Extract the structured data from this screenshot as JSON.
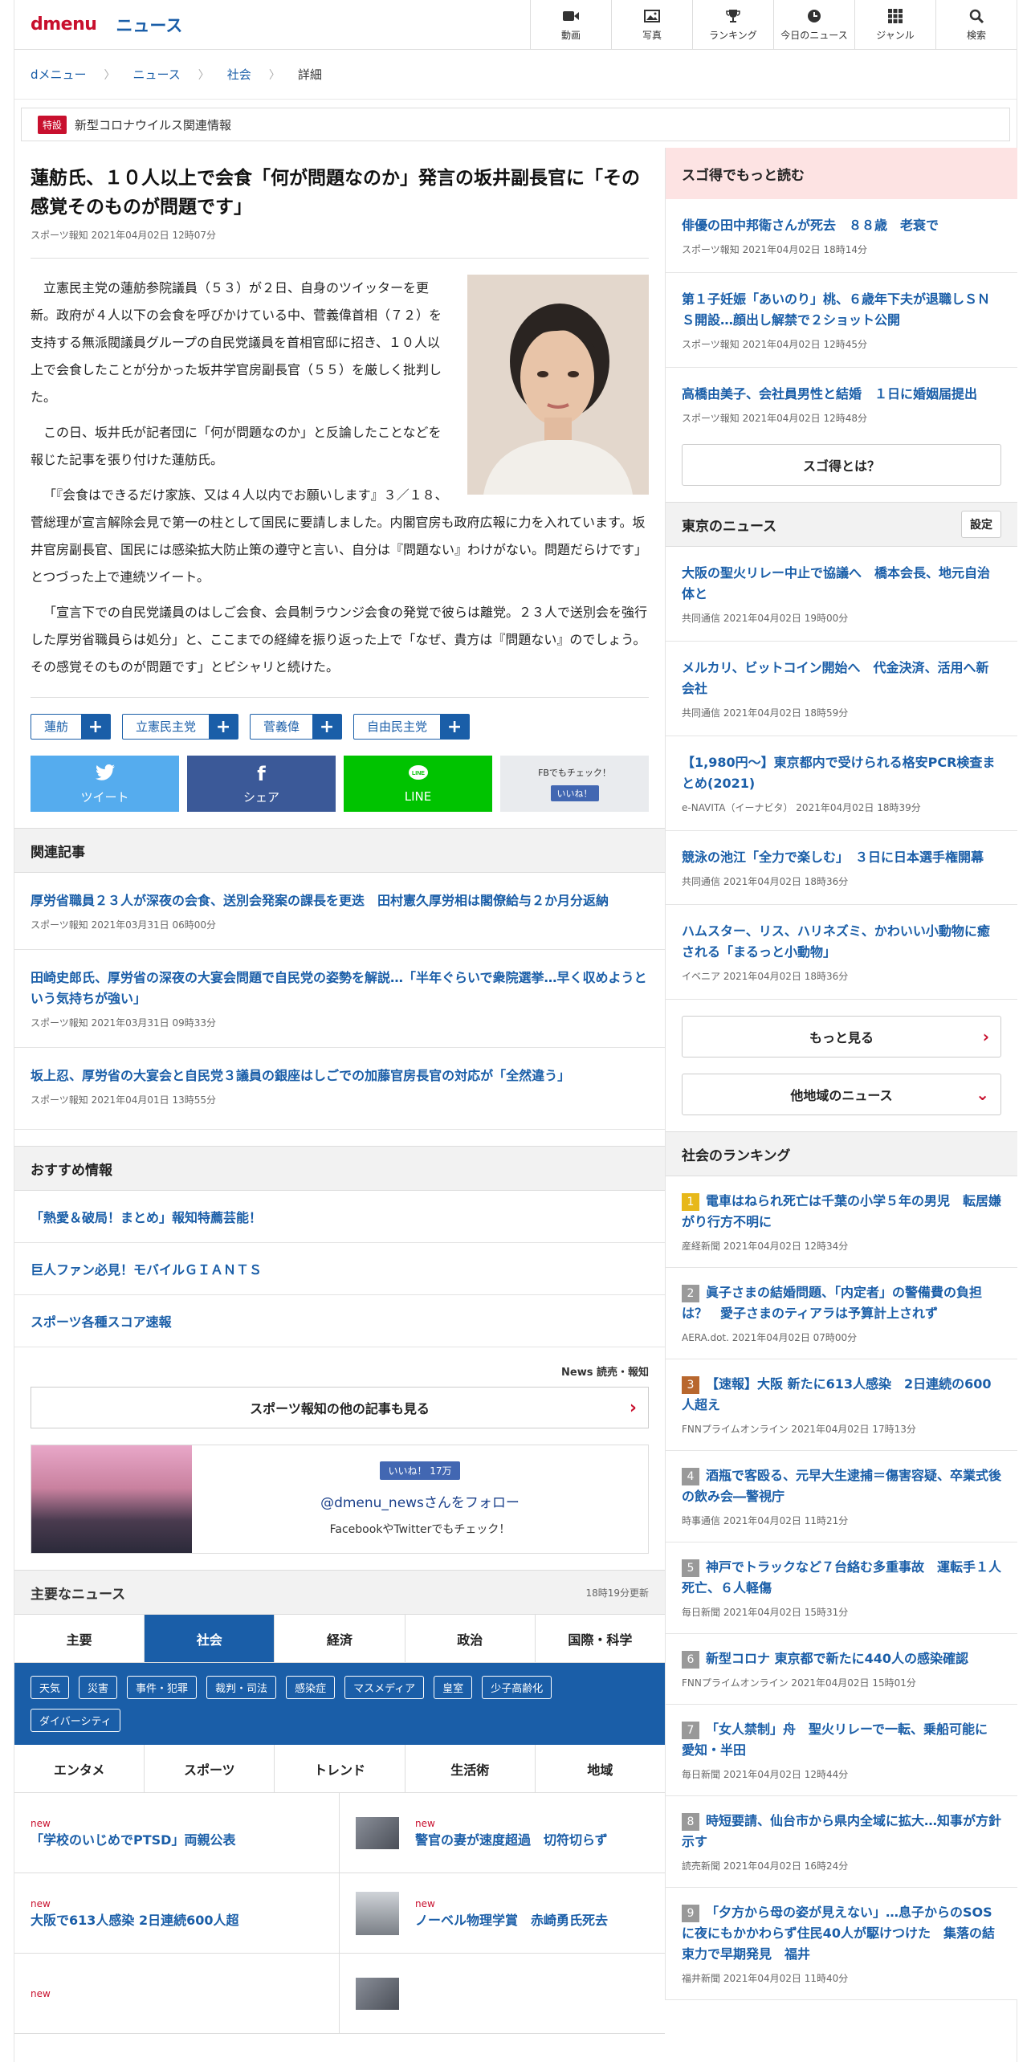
{
  "header": {
    "logo": "dmenu",
    "section": "ニュース",
    "nav": [
      {
        "label": "動画",
        "icon": "video-icon"
      },
      {
        "label": "写真",
        "icon": "photo-icon"
      },
      {
        "label": "ランキング",
        "icon": "trophy-icon"
      },
      {
        "label": "今日のニュース",
        "icon": "clock-icon"
      },
      {
        "label": "ジャンル",
        "icon": "grid-icon"
      },
      {
        "label": "検索",
        "icon": "search-icon"
      }
    ]
  },
  "breadcrumb": [
    "dメニュー",
    "ニュース",
    "社会",
    "詳細"
  ],
  "special": {
    "tag": "特設",
    "label": "新型コロナウイルス関連情報"
  },
  "article": {
    "title": "蓮舫氏、１０人以上で会食「何が問題なのか」発言の坂井副長官に「その感覚そのものが問題です」",
    "meta": "スポーツ報知 2021年04月02日 12時07分",
    "paragraphs": [
      "立憲民主党の蓮舫参院議員（５３）が２日、自身のツイッターを更新。政府が４人以下の会食を呼びかけている中、菅義偉首相（７２）を支持する無派閥議員グループの自民党議員を首相官邸に招き、１０人以上で会食したことが分かった坂井学官房副長官（５５）を厳しく批判した。",
      "この日、坂井氏が記者団に「何が問題なのか」と反論したことなどを報じた記事を張り付けた蓮舫氏。",
      "「『会食はできるだけ家族、又は４人以内でお願いします』３／１８、菅総理が宣言解除会見で第一の柱として国民に要請しました。内閣官房も政府広報に力を入れています。坂井官房副長官、国民には感染拡大防止策の遵守と言い、自分は『問題ない』わけがない。問題だらけです」とつづった上で連続ツイート。",
      "「宣言下での自民党議員のはしご会食、会員制ラウンジ会食の発覚で彼らは離党。２３人で送別会を強行した厚労省職員らは処分」と、ここまでの経緯を振り返った上で「なぜ、貴方は『問題ない』のでしょう。その感覚そのものが問題です」とピシャリと続けた。"
    ],
    "tags": [
      "蓮舫",
      "立憲民主党",
      "菅義偉",
      "自由民主党"
    ],
    "share": {
      "tweet": "ツイート",
      "facebook": "シェア",
      "line": "LINE",
      "fb_check": "FBでもチェック！",
      "like": "いいね！"
    }
  },
  "related": {
    "heading": "関連記事",
    "items": [
      {
        "title": "厚労省職員２３人が深夜の会食、送別会発案の課長を更迭　田村憲久厚労相は閣僚給与２か月分返納",
        "meta": "スポーツ報知 2021年03月31日 06時00分"
      },
      {
        "title": "田崎史郎氏、厚労省の深夜の大宴会問題で自民党の姿勢を解説…「半年ぐらいで衆院選挙…早く収めようという気持ちが強い」",
        "meta": "スポーツ報知 2021年03月31日 09時33分"
      },
      {
        "title": "坂上忍、厚労省の大宴会と自民党３議員の銀座はしごでの加藤官房長官の対応が「全然違う」",
        "meta": "スポーツ報知 2021年04月01日 13時55分"
      }
    ]
  },
  "recommend": {
    "heading": "おすすめ情報",
    "items": [
      "「熱愛＆破局！まとめ」報知特薦芸能！",
      "巨人ファン必見！モバイルＧＩＡＮＴＳ",
      "スポーツ各種スコア速報"
    ]
  },
  "publisher": {
    "logo": "News 読売・報知",
    "more": "スポーツ報知の他の記事も見る"
  },
  "follow": {
    "like": "いいね！ 17万",
    "account": "@dmenu_newsさんをフォロー",
    "sub": "FacebookやTwitterでもチェック！"
  },
  "major": {
    "heading": "主要なニュース",
    "updated": "18時19分更新",
    "tabs1": [
      "主要",
      "社会",
      "経済",
      "政治",
      "国際・科学"
    ],
    "active": "社会",
    "chips": [
      "天気",
      "災害",
      "事件・犯罪",
      "裁判・司法",
      "感染症",
      "マスメディア",
      "皇室",
      "少子高齢化",
      "ダイバーシティ"
    ],
    "tabs2": [
      "エンタメ",
      "スポーツ",
      "トレンド",
      "生活術",
      "地域"
    ],
    "news": [
      {
        "badge": "new",
        "title": "「学校のいじめでPTSD」両親公表",
        "thumb": false
      },
      {
        "badge": "new",
        "title": "警官の妻が速度超過　切符切らず",
        "thumb": true
      },
      {
        "badge": "new",
        "title": "大阪で613人感染 2日連続600人超",
        "thumb": false
      },
      {
        "badge": "new",
        "title": "ノーベル物理学賞　赤崎勇氏死去",
        "thumb": true
      },
      {
        "badge": "new",
        "title": "",
        "thumb": false
      },
      {
        "badge": "",
        "title": "",
        "thumb": true
      }
    ]
  },
  "side": {
    "sugo_heading": "スゴ得でもっと読む",
    "sugo": [
      {
        "title": "俳優の田中邦衛さんが死去　８８歳　老衰で",
        "meta": "スポーツ報知 2021年04月02日 18時14分"
      },
      {
        "title": "第１子妊娠「あいのり」桃、６歳年下夫が退職しＳＮＳ開設…顔出し解禁で２ショット公開",
        "meta": "スポーツ報知 2021年04月02日 12時45分"
      },
      {
        "title": "高橋由美子、会社員男性と結婚　１日に婚姻届提出",
        "meta": "スポーツ報知 2021年04月02日 12時48分"
      }
    ],
    "sugo_btn": "スゴ得とは？",
    "tokyo_heading": "東京のニュース",
    "tokyo_setting": "設定",
    "tokyo": [
      {
        "title": "大阪の聖火リレー中止で協議へ　橋本会長、地元自治体と",
        "meta": "共同通信  2021年04月02日 19時00分"
      },
      {
        "title": "メルカリ、ビットコイン開始へ　代金決済、活用へ新会社",
        "meta": "共同通信  2021年04月02日 18時59分"
      },
      {
        "title": "【1,980円〜】東京都内で受けられる格安PCR検査まとめ(2021)",
        "meta": "e-NAVITA（イーナビタ）  2021年04月02日 18時39分"
      },
      {
        "title": "競泳の池江「全力で楽しむ」　３日に日本選手権開幕",
        "meta": "共同通信  2021年04月02日 18時36分"
      },
      {
        "title": "ハムスター、リス、ハリネズミ、かわいい小動物に癒される「まるっと小動物」",
        "meta": "イベニア  2021年04月02日 18時36分"
      }
    ],
    "more": "もっと見る",
    "other_region": "他地域のニュース",
    "ranking_heading": "社会のランキング",
    "ranking": [
      {
        "n": "1",
        "title": "電車はねられ死亡は千葉の小学５年の男児　転居嫌がり行方不明に",
        "meta": "産経新聞 2021年04月02日 12時34分",
        "color": "#e7b81a"
      },
      {
        "n": "2",
        "title": "眞子さまの結婚問題、「内定者」の警備費の負担は？　愛子さまのティアラは予算計上されず",
        "meta": "AERA.dot. 2021年04月02日 07時00分",
        "color": "#9a9a9a"
      },
      {
        "n": "3",
        "title": "【速報】大阪 新たに613人感染　2日連続の600人超え",
        "meta": "FNNプライムオンライン 2021年04月02日 17時13分",
        "color": "#b8672e"
      },
      {
        "n": "4",
        "title": "酒瓶で客殴る、元早大生逮捕＝傷害容疑、卒業式後の飲み会―警視庁",
        "meta": "時事通信 2021年04月02日 11時21分",
        "color": "#999"
      },
      {
        "n": "5",
        "title": "神戸でトラックなど７台絡む多重事故　運転手１人死亡、６人軽傷",
        "meta": "毎日新聞 2021年04月02日 15時31分",
        "color": "#999"
      },
      {
        "n": "6",
        "title": "新型コロナ 東京都で新たに440人の感染確認",
        "meta": "FNNプライムオンライン 2021年04月02日 15時01分",
        "color": "#999"
      },
      {
        "n": "7",
        "title": "「女人禁制」舟　聖火リレーで一転、乗船可能に　愛知・半田",
        "meta": "毎日新聞 2021年04月02日 12時44分",
        "color": "#999"
      },
      {
        "n": "8",
        "title": "時短要請、仙台市から県内全域に拡大…知事が方針示す",
        "meta": "読売新聞 2021年04月02日 16時24分",
        "color": "#999"
      },
      {
        "n": "9",
        "title": "「夕方から母の姿が見えない」…息子からのSOSに夜にもかかわらず住民40人が駆けつけた　集落の結束力で早期発見　福井",
        "meta": "福井新聞 2021年04月02日 11時40分",
        "color": "#999"
      }
    ]
  }
}
